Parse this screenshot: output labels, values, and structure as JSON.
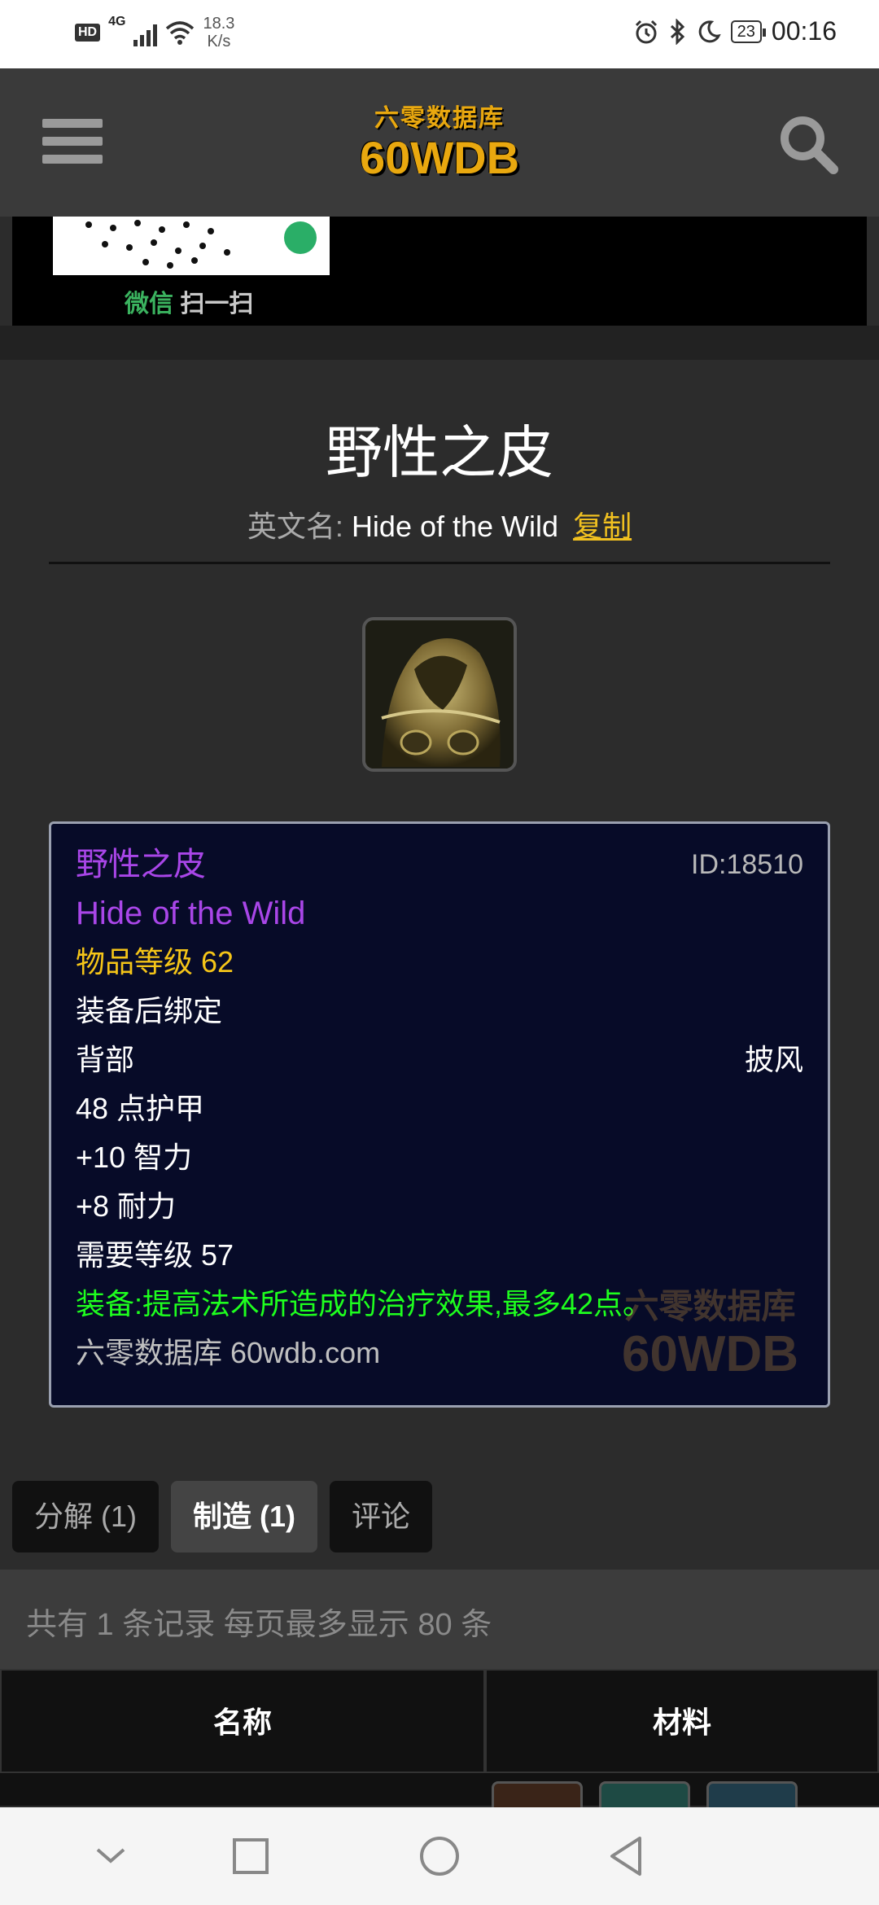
{
  "status_bar": {
    "hd": "HD",
    "network": "4G",
    "speed_value": "18.3",
    "speed_unit": "K/s",
    "battery": "23",
    "time": "00:16"
  },
  "header": {
    "logo_top": "六零数据库",
    "logo_main": "60WDB"
  },
  "banner": {
    "scan_wechat": "微信",
    "scan_text": "扫一扫"
  },
  "item": {
    "title": "野性之皮",
    "en_label": "英文名:",
    "en_name": "Hide of the Wild",
    "copy_label": "复制"
  },
  "tooltip": {
    "name_cn": "野性之皮",
    "id": "ID:18510",
    "name_en": "Hide of the Wild",
    "item_level": "物品等级 62",
    "bind": "装备后绑定",
    "slot": "背部",
    "type": "披风",
    "armor": "48 点护甲",
    "stat_int": "+10 智力",
    "stat_sta": "+8 耐力",
    "req_level": "需要等级 57",
    "equip_effect": "装备:提高法术所造成的治疗效果,最多42点。",
    "site": "六零数据库 60wdb.com",
    "watermark_top": "六零数据库",
    "watermark_main": "60WDB"
  },
  "tabs": [
    {
      "label": "分解 (1)"
    },
    {
      "label": "制造 (1)"
    },
    {
      "label": "评论"
    }
  ],
  "records_text": "共有 1 条记录 每页最多显示 80 条",
  "table": {
    "col_name": "名称",
    "col_materials": "材料"
  },
  "colors": {
    "epic": "#a946e8",
    "item_level": "#f5c518",
    "equip_green": "#1eff1e",
    "tooltip_bg": "#070b28"
  }
}
